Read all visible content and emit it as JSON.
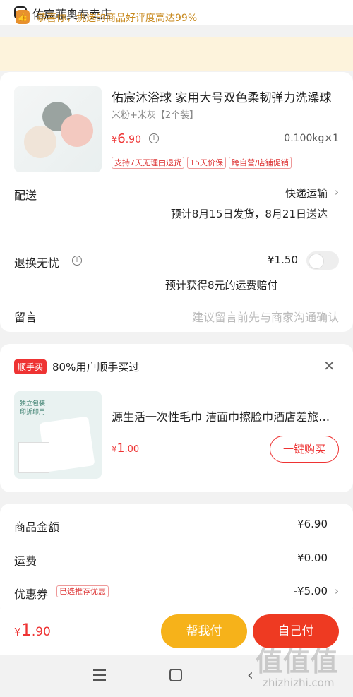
{
  "store": {
    "name": "佑宸菲奥专卖店"
  },
  "banner": {
    "text": "恭喜你，挑选的商品好评度高达99%"
  },
  "product": {
    "title": "佑宸沐浴球 家用大号双色柔韧弹力洗澡球",
    "spec": "米粉+米灰【2个装】",
    "price_currency": "¥",
    "price_int": "6",
    "price_dec": ".90",
    "weight_qty": "0.100kg×1",
    "tags": [
      "支持7天无理由退货",
      "15天价保",
      "跨自营/店铺促销"
    ]
  },
  "delivery": {
    "label": "配送",
    "method": "快递运输",
    "estimate": "预计8月15日发货，8月21日送达"
  },
  "returns": {
    "label": "退换无忧",
    "price": "¥1.50",
    "note": "预计获得8元的运费赔付"
  },
  "message": {
    "label": "留言",
    "placeholder": "建议留言前先与商家沟通确认"
  },
  "recommend": {
    "badge": "顺手买",
    "title": "80%用户顺手买过",
    "item_name": "源生活一次性毛巾 洁面巾擦脸巾酒店差旅便携装",
    "price_currency": "¥",
    "price_int": "1",
    "price_dec": ".00",
    "buy_label": "一键购买",
    "img_text": "独立包装 印折印用"
  },
  "summary": {
    "goods_label": "商品金额",
    "goods_value": "¥6.90",
    "shipping_label": "运费",
    "shipping_value": "¥0.00",
    "coupon_label": "优惠券",
    "coupon_tag": "已选推荐优惠",
    "coupon_value": "-¥5.00"
  },
  "bottom": {
    "total_currency": "¥",
    "total_int": "1",
    "total_dec": ".90",
    "help_pay": "帮我付",
    "self_pay": "自己付"
  },
  "watermark": {
    "logo": "值值值",
    "url": "zhizhizhi.com"
  },
  "colors": {
    "accent_red": "#ee3a22",
    "accent_yellow": "#f6b21a",
    "banner_bg": "#fdf3dc"
  }
}
